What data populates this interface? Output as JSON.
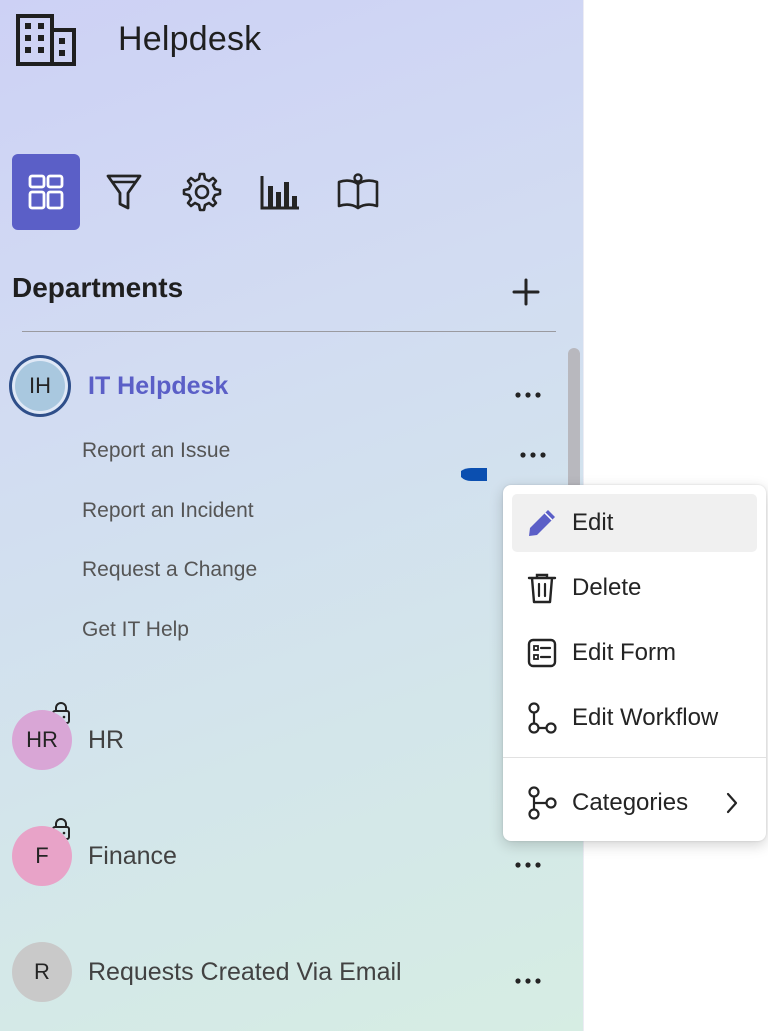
{
  "app": {
    "title": "Helpdesk",
    "logo_icon": "building-icon"
  },
  "nav": {
    "items": [
      {
        "icon": "dashboard-grid-icon",
        "active": true
      },
      {
        "icon": "filter-icon",
        "active": false
      },
      {
        "icon": "gear-icon",
        "active": false
      },
      {
        "icon": "bar-chart-icon",
        "active": false
      },
      {
        "icon": "book-open-icon",
        "active": false
      }
    ],
    "accent_color": "#5b5fc7"
  },
  "departments": {
    "heading": "Departments",
    "add_icon": "plus-icon",
    "items": [
      {
        "initials": "IH",
        "name": "IT Helpdesk",
        "avatar_color": "#a9c8df",
        "selected": true,
        "locked": false,
        "sub_items": [
          "Report an Issue",
          "Report an Incident",
          "Request a Change",
          "Get IT Help"
        ]
      },
      {
        "initials": "HR",
        "name": "HR",
        "avatar_color": "#d9a6d6",
        "selected": false,
        "locked": true
      },
      {
        "initials": "F",
        "name": "Finance",
        "avatar_color": "#e8a3c8",
        "selected": false,
        "locked": true
      },
      {
        "initials": "R",
        "name": "Requests Created Via Email",
        "avatar_color": "#c9c9c9",
        "selected": false,
        "locked": false
      }
    ]
  },
  "context_menu": {
    "items": [
      {
        "label": "Edit",
        "icon": "pencil-icon"
      },
      {
        "label": "Delete",
        "icon": "trash-icon"
      },
      {
        "label": "Edit Form",
        "icon": "form-icon"
      },
      {
        "label": "Edit Workflow",
        "icon": "workflow-icon"
      },
      {
        "label": "Categories",
        "icon": "branch-icon"
      }
    ]
  }
}
